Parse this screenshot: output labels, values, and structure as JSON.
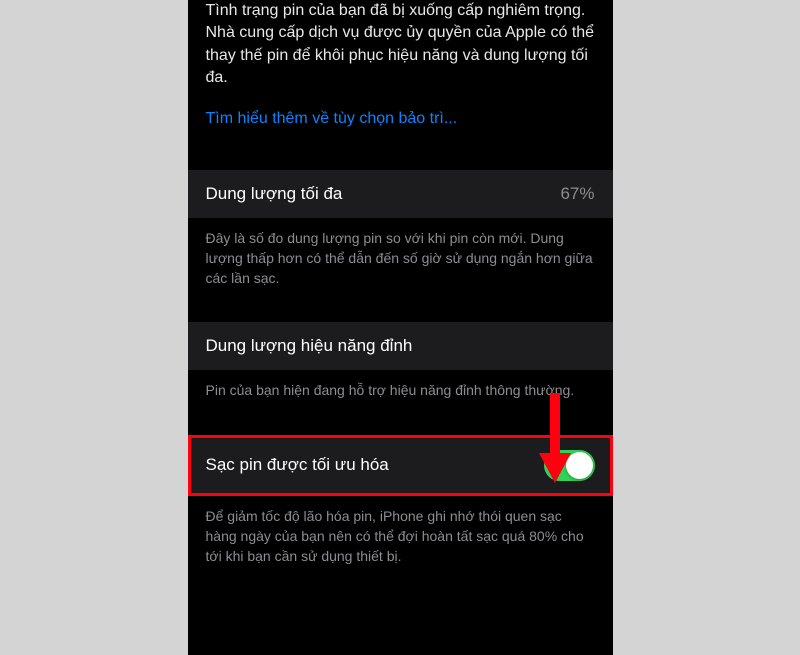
{
  "warning": {
    "text": "Tình trạng pin của bạn đã bị xuống cấp nghiêm trọng. Nhà cung cấp dịch vụ được ủy quyền của Apple có thể thay thế pin để khôi phục hiệu năng và dung lượng tối đa."
  },
  "link": {
    "label": "Tìm hiểu thêm về tùy chọn bảo trì..."
  },
  "capacity": {
    "label": "Dung lượng tối đa",
    "value": "67%",
    "description": "Đây là số đo dung lượng pin so với khi pin còn mới. Dung lượng thấp hơn có thể dẫn đến số giờ sử dụng ngắn hơn giữa các lần sạc."
  },
  "peak": {
    "label": "Dung lượng hiệu năng đỉnh",
    "description": "Pin của bạn hiện đang hỗ trợ hiệu năng đỉnh thông thường."
  },
  "optimized": {
    "label": "Sạc pin được tối ưu hóa",
    "description": "Để giảm tốc độ lão hóa pin, iPhone ghi nhớ thói quen sạc hàng ngày của bạn nên có thể đợi hoàn tất sạc quá 80% cho tới khi bạn cần sử dụng thiết bị."
  }
}
